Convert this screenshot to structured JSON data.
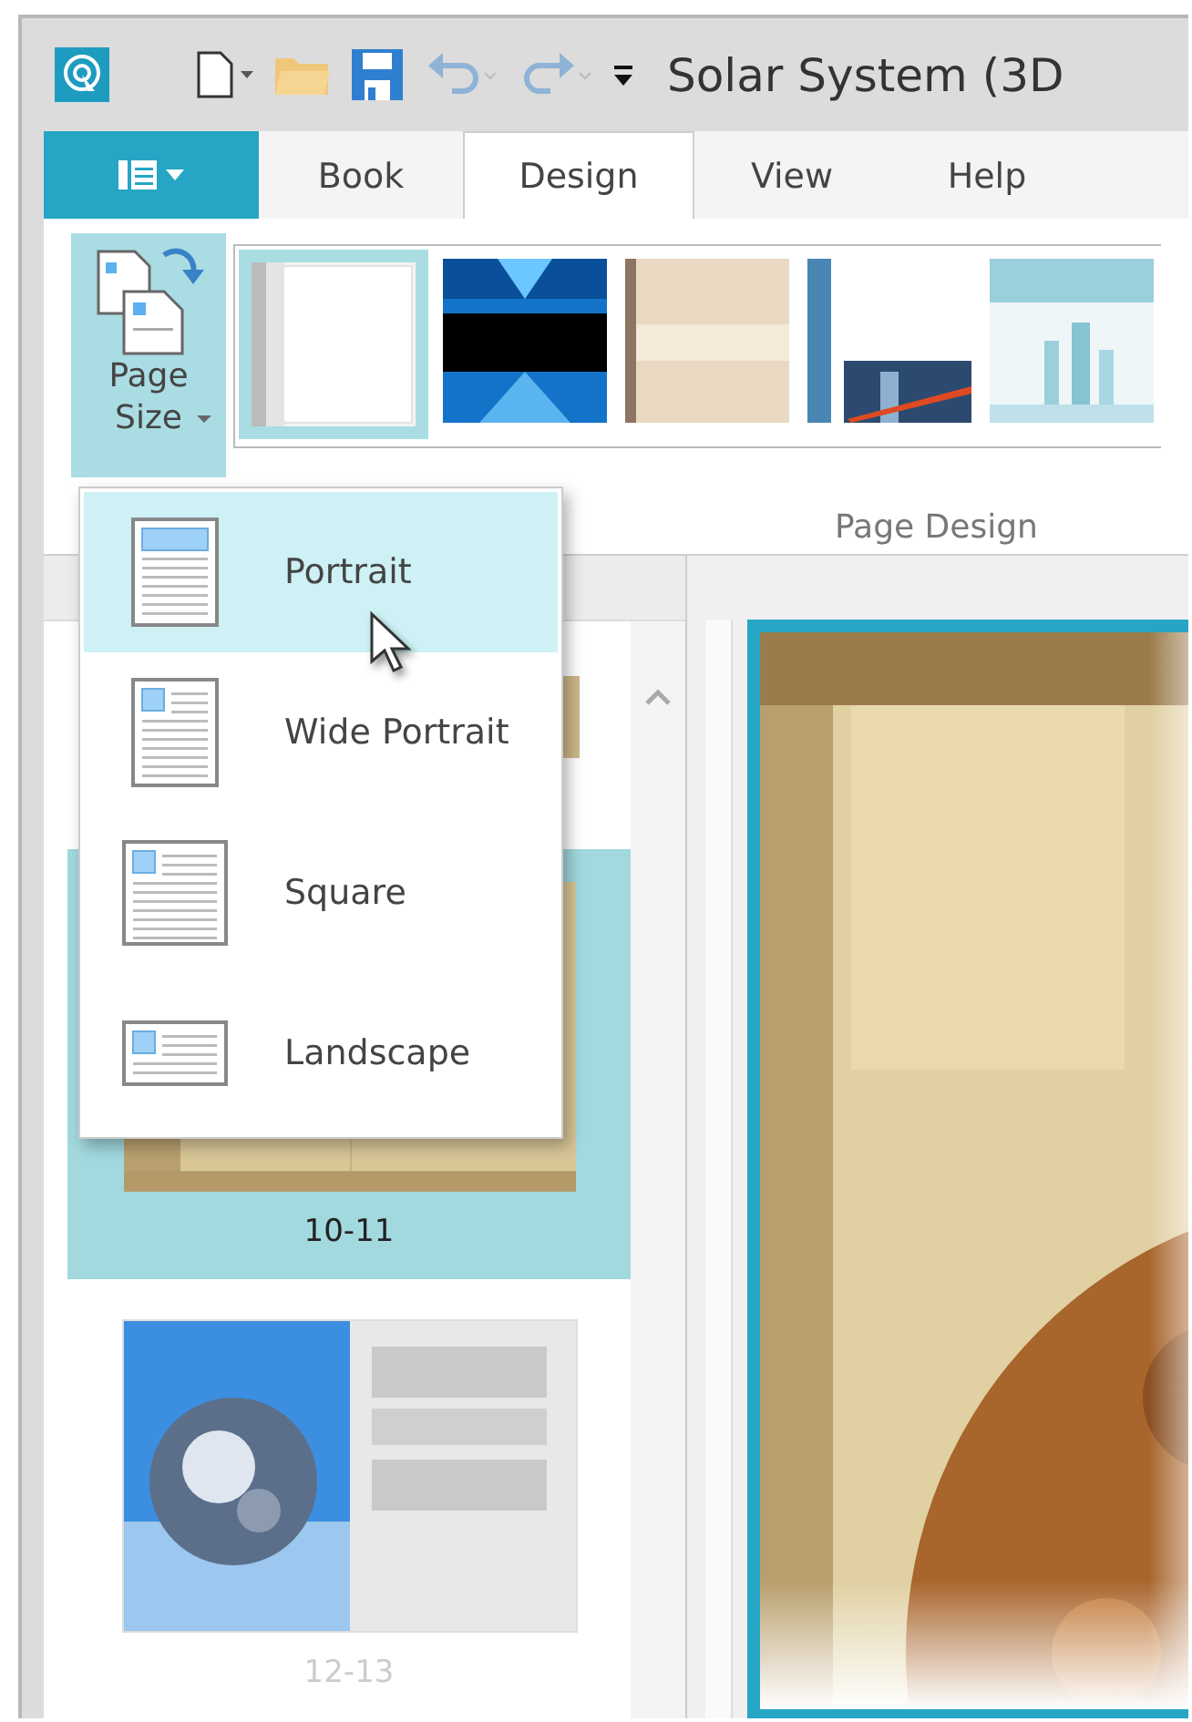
{
  "window": {
    "title": "Solar System (3D"
  },
  "tabs": [
    {
      "label": "Book",
      "selected": false
    },
    {
      "label": "Design",
      "selected": true
    },
    {
      "label": "View",
      "selected": false
    },
    {
      "label": "Help",
      "selected": false
    }
  ],
  "ribbon": {
    "page_size_button": {
      "label": "Page Size",
      "expanded": true
    },
    "designs": [
      {
        "selected": true
      },
      {
        "selected": false
      },
      {
        "selected": false
      },
      {
        "selected": false
      },
      {
        "selected": false
      }
    ],
    "group_label": "Page Design"
  },
  "page_size_menu": [
    {
      "kind": "portrait",
      "label": "Portrait",
      "selected": true
    },
    {
      "kind": "wide",
      "label": "Wide Portrait",
      "selected": false
    },
    {
      "kind": "square",
      "label": "Square",
      "selected": false
    },
    {
      "kind": "landscape",
      "label": "Landscape",
      "selected": false
    }
  ],
  "pages": [
    {
      "label": "10-11",
      "selected": true
    },
    {
      "label": "12-13",
      "selected": false
    }
  ]
}
